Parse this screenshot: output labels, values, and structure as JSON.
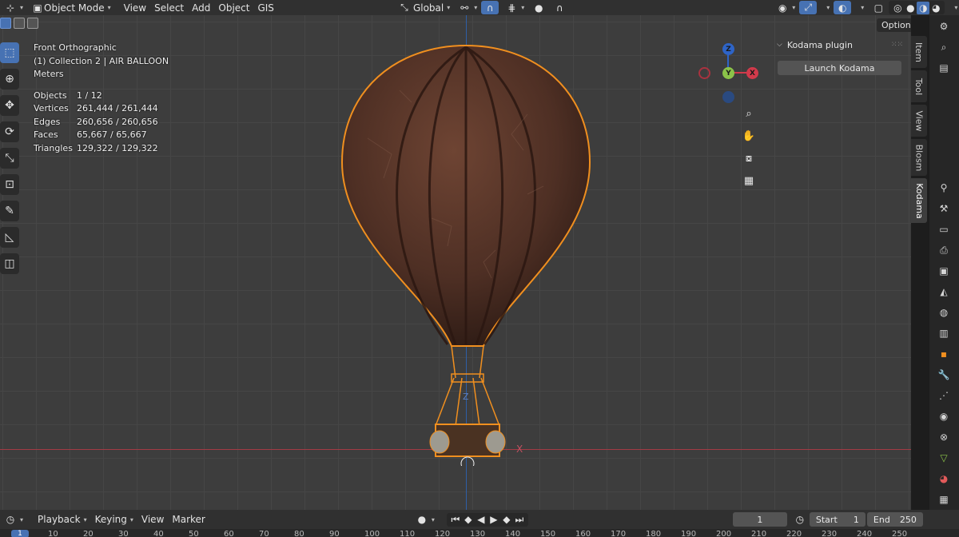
{
  "header": {
    "editor_mode": "Object Mode",
    "menus": [
      "View",
      "Select",
      "Add",
      "Object",
      "GIS"
    ],
    "transform_orientation": "Global",
    "options_label": "Options"
  },
  "overlay": {
    "view_name": "Front Orthographic",
    "collection": "(1) Collection 2 | AIR BALLOON",
    "units": "Meters",
    "stats": [
      {
        "label": "Objects",
        "value": "1 / 12"
      },
      {
        "label": "Vertices",
        "value": "261,444 / 261,444"
      },
      {
        "label": "Edges",
        "value": "260,656 / 260,656"
      },
      {
        "label": "Faces",
        "value": "65,667 / 65,667"
      },
      {
        "label": "Triangles",
        "value": "129,322 / 129,322"
      }
    ]
  },
  "gizmo": {
    "z": "Z",
    "y": "Y",
    "x": "X"
  },
  "npanel": {
    "title": "Kodama plugin",
    "button": "Launch Kodama",
    "tabs": [
      "Item",
      "Tool",
      "View",
      "Blosm",
      "Kodama"
    ]
  },
  "scene_labels": {
    "z_axis": "Z",
    "x_axis": "X"
  },
  "timeline": {
    "menus": [
      "Playback",
      "Keying",
      "View",
      "Marker"
    ],
    "current_frame": "1",
    "start_label": "Start",
    "start_value": "1",
    "end_label": "End",
    "end_value": "250",
    "playhead": "1",
    "ruler": [
      "10",
      "20",
      "30",
      "40",
      "50",
      "60",
      "70",
      "80",
      "90",
      "100",
      "110",
      "120",
      "130",
      "140",
      "150",
      "160",
      "170",
      "180",
      "190",
      "200",
      "210",
      "220",
      "230",
      "240",
      "250"
    ]
  },
  "colors": {
    "accent": "#4772b3",
    "selection": "#f08f1f",
    "x_axis": "#a33a45",
    "y_axis": "#8bc349",
    "z_axis": "#2e5fa7"
  }
}
